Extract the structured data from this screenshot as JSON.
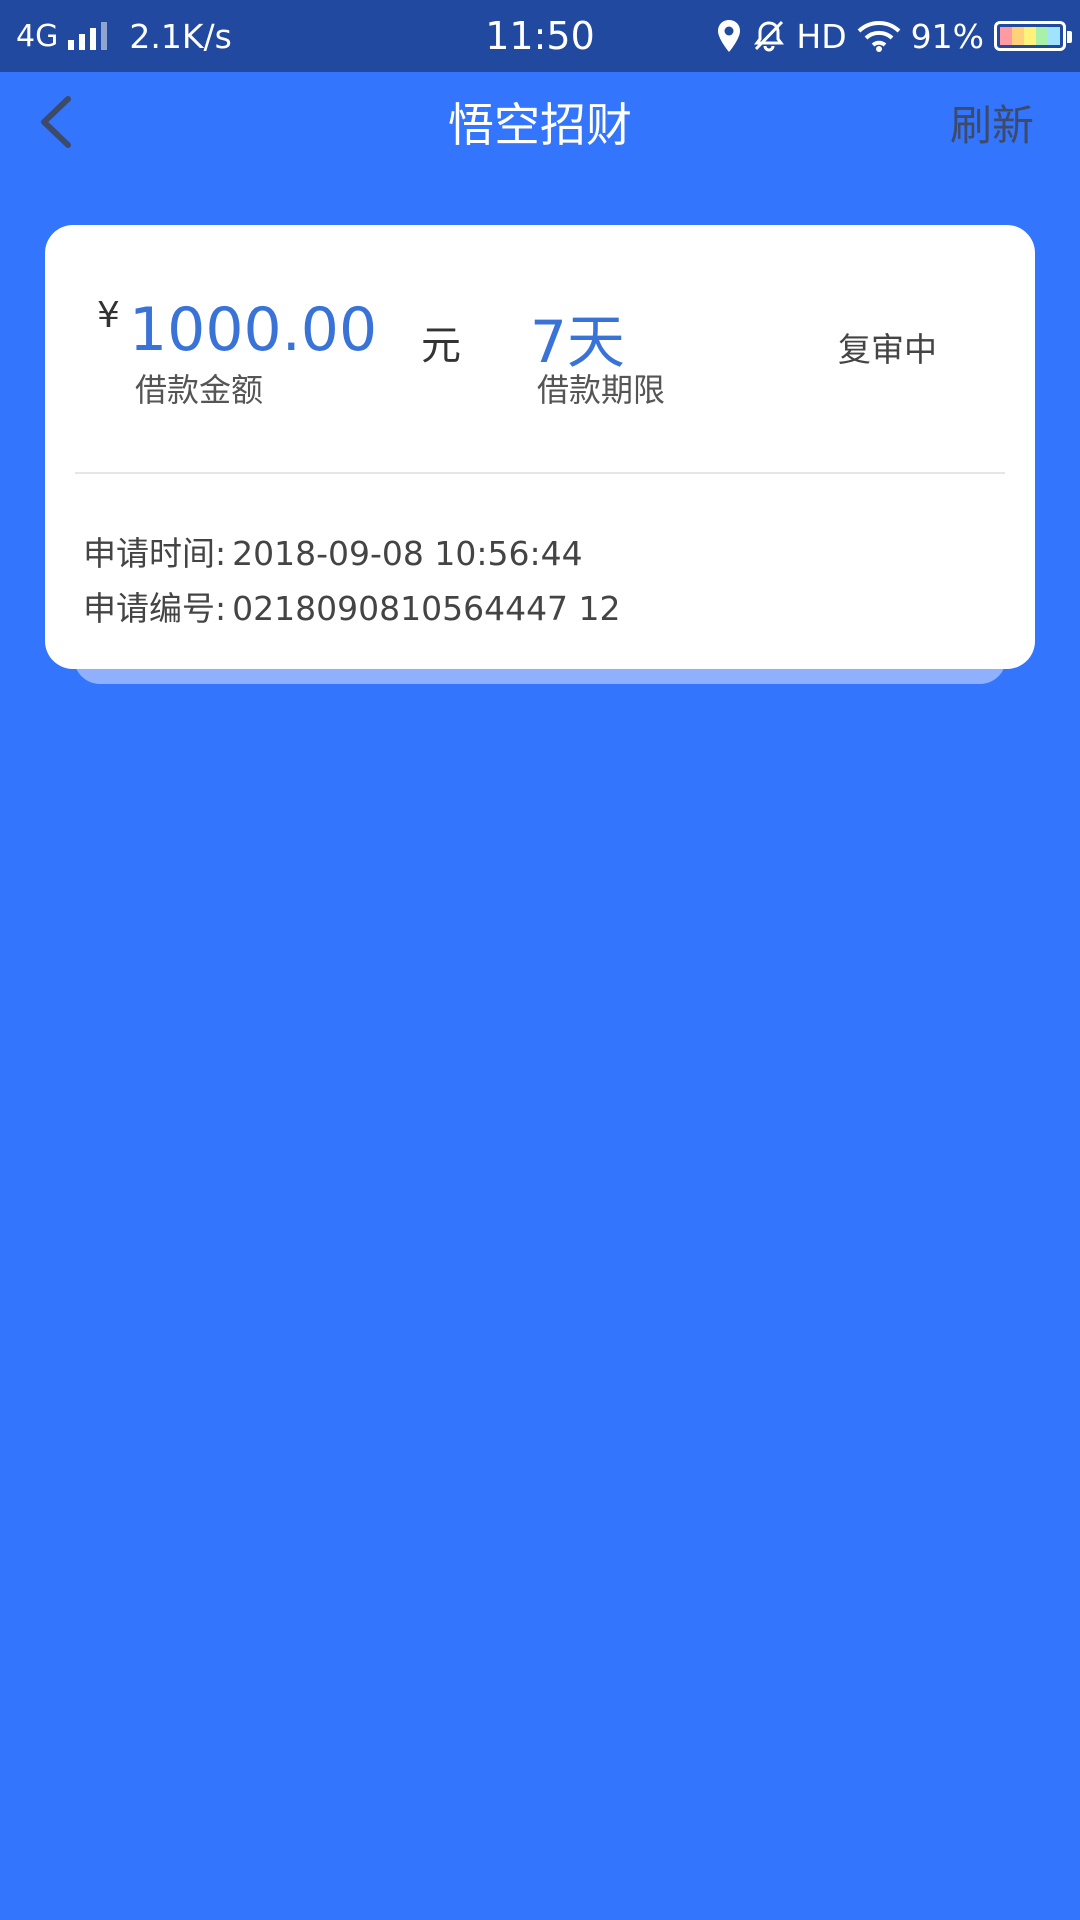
{
  "status_bar": {
    "network": "4G",
    "speed": "2.1K/s",
    "time": "11:50",
    "hd": "HD",
    "battery": "91%"
  },
  "nav": {
    "title": "悟空招财",
    "refresh_label": "刷新"
  },
  "loan": {
    "currency_symbol": "¥",
    "amount": "1000.00",
    "amount_unit": "元",
    "amount_label": "借款金额",
    "term": "7天",
    "term_label": "借款期限",
    "status": "复审中"
  },
  "details": {
    "apply_time_label": "申请时间:",
    "apply_time": "2018-09-08 10:56:44",
    "apply_no_label": "申请编号:",
    "apply_no": "0218090810564447 12"
  },
  "colors": {
    "background": "#3376fd",
    "status_bar": "#2149a0",
    "accent_blue": "#3a73d8"
  }
}
